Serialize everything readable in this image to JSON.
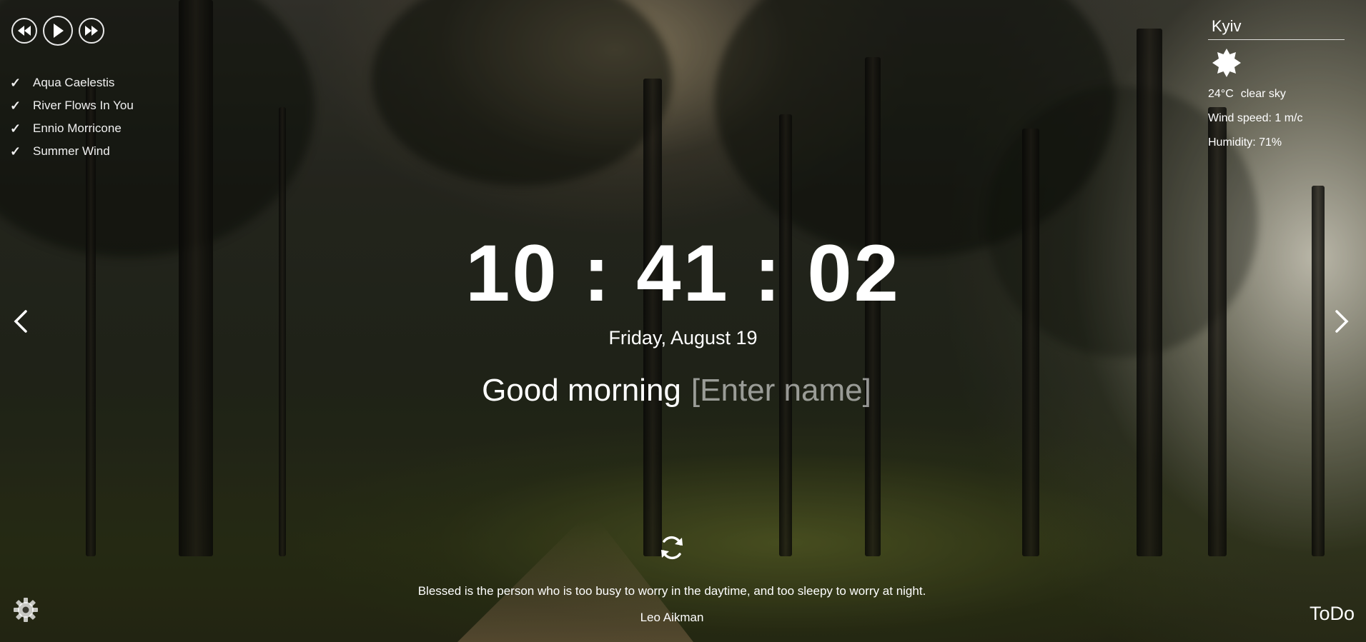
{
  "player": {
    "prev_icon": "rewind-icon",
    "play_icon": "play-icon",
    "next_icon": "fast-forward-icon",
    "check_glyph": "✓",
    "tracks": [
      {
        "title": "Aqua Caelestis"
      },
      {
        "title": "River Flows In You"
      },
      {
        "title": "Ennio Morricone"
      },
      {
        "title": "Summer Wind"
      }
    ]
  },
  "weather": {
    "city": "Kyiv",
    "icon": "clear-sky-sun-icon",
    "temperature": "24°C",
    "description": "clear sky",
    "wind": "Wind speed: 1 m/c",
    "humidity": "Humidity: 71%"
  },
  "slider": {
    "prev_icon": "chevron-left-icon",
    "next_icon": "chevron-right-icon"
  },
  "clock": {
    "time": "10 : 41 : 02",
    "date": "Friday, August 19"
  },
  "greeting": {
    "text": "Good morning",
    "name_placeholder": "[Enter name]",
    "name_value": ""
  },
  "quote": {
    "refresh_icon": "refresh-icon",
    "text": "Blessed is the person who is too busy to worry in the daytime, and too sleepy to worry at night.",
    "author": "Leo Aikman"
  },
  "footer": {
    "settings_icon": "gear-icon",
    "todo_label": "ToDo"
  },
  "colors": {
    "text": "#ffffff",
    "placeholder": "#bdbdb5"
  }
}
